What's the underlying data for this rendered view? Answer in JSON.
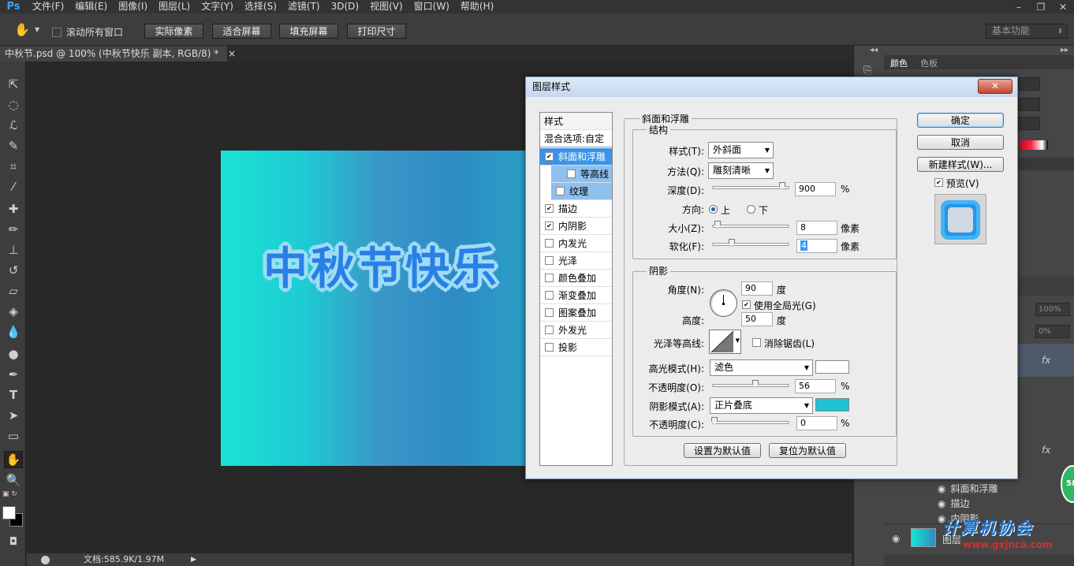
{
  "app": {
    "logo": "Ps"
  },
  "menubar": {
    "items": [
      "文件(F)",
      "编辑(E)",
      "图像(I)",
      "图层(L)",
      "文字(Y)",
      "选择(S)",
      "滤镜(T)",
      "3D(D)",
      "视图(V)",
      "窗口(W)",
      "帮助(H)"
    ]
  },
  "window_controls": {
    "minimize": "–",
    "restore": "❐",
    "close": "✕"
  },
  "options": {
    "scroll_all_label": "滚动所有窗口",
    "actual_pixels": "实际像素",
    "fit_screen": "适合屏幕",
    "fill_screen": "填充屏幕",
    "print_size": "打印尺寸",
    "workspace": "基本功能"
  },
  "document": {
    "tab_title": "中秋节.psd @ 100% (中秋节快乐 副本, RGB/8) *",
    "tab_close": "×",
    "canvas_text": "中秋节快乐",
    "status": "文档:585.9K/1.97M"
  },
  "right_panel": {
    "tab_color": "颜色",
    "tab_swatches": "色板",
    "opacity": "100%",
    "fill": "0%",
    "fx1": "fx",
    "fx2": "fx",
    "effects": [
      "斜面和浮雕",
      "描边",
      "内阴影"
    ],
    "layer_name": "图层",
    "badge": "58",
    "watermark": "计算机协会",
    "watermark_url": "www.gxjnca.com"
  },
  "dialog": {
    "title": "图层样式",
    "close": "✕",
    "styles_header": "样式",
    "blend_options": "混合选项:自定",
    "style_items": [
      {
        "label": "斜面和浮雕",
        "checked": true
      },
      {
        "label": "等高线",
        "checked": false
      },
      {
        "label": "纹理",
        "checked": false
      },
      {
        "label": "描边",
        "checked": true
      },
      {
        "label": "内阴影",
        "checked": true
      },
      {
        "label": "内发光",
        "checked": false
      },
      {
        "label": "光泽",
        "checked": false
      },
      {
        "label": "颜色叠加",
        "checked": false
      },
      {
        "label": "渐变叠加",
        "checked": false
      },
      {
        "label": "图案叠加",
        "checked": false
      },
      {
        "label": "外发光",
        "checked": false
      },
      {
        "label": "投影",
        "checked": false
      }
    ],
    "section_title": "斜面和浮雕",
    "structure": {
      "group": "结构",
      "style_label": "样式(T):",
      "style_value": "外斜面",
      "technique_label": "方法(Q):",
      "technique_value": "雕刻清晰",
      "depth_label": "深度(D):",
      "depth_value": "900",
      "depth_unit": "%",
      "direction_label": "方向:",
      "dir_up": "上",
      "dir_down": "下",
      "size_label": "大小(Z):",
      "size_value": "8",
      "size_unit": "像素",
      "soften_label": "软化(F):",
      "soften_value": "4",
      "soften_unit": "像素"
    },
    "shading": {
      "group": "阴影",
      "angle_label": "角度(N):",
      "angle_value": "90",
      "angle_unit": "度",
      "global_light": "使用全局光(G)",
      "altitude_label": "高度:",
      "altitude_value": "50",
      "altitude_unit": "度",
      "gloss_label": "光泽等高线:",
      "antialias": "消除锯齿(L)",
      "highlight_label": "高光模式(H):",
      "highlight_value": "滤色",
      "highlight_color": "#ffffff",
      "hl_opacity_label": "不透明度(O):",
      "hl_opacity_value": "56",
      "hl_opacity_unit": "%",
      "shadow_label": "阴影模式(A):",
      "shadow_value": "正片叠底",
      "shadow_color": "#1fc3d3",
      "sh_opacity_label": "不透明度(C):",
      "sh_opacity_value": "0",
      "sh_opacity_unit": "%"
    },
    "set_default": "设置为默认值",
    "reset_default": "复位为默认值",
    "ok": "确定",
    "cancel": "取消",
    "new_style": "新建样式(W)...",
    "preview": "预览(V)"
  }
}
